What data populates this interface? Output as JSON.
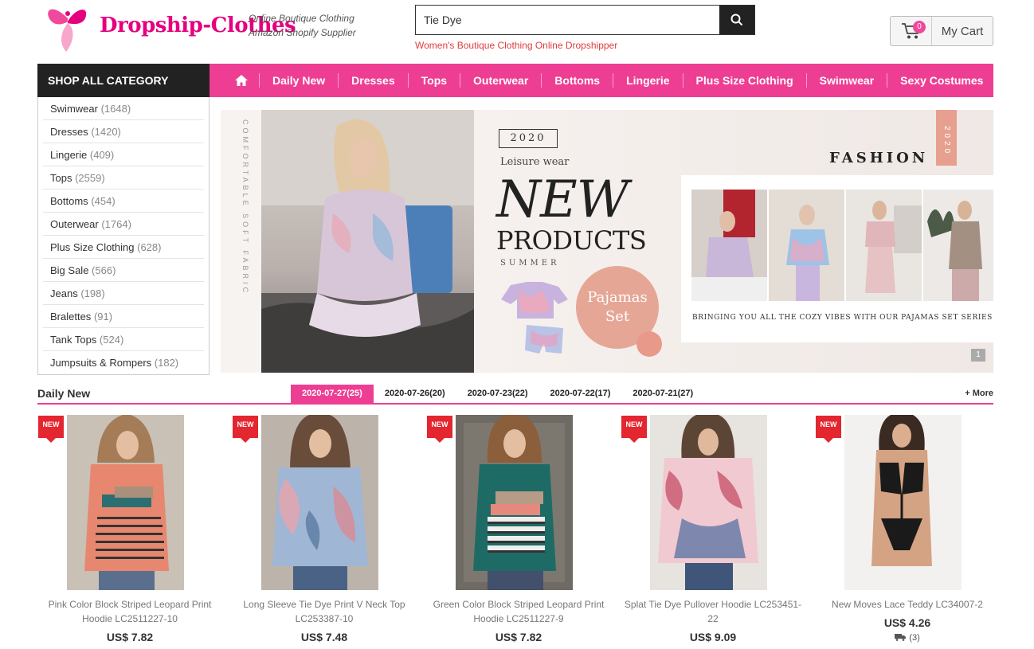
{
  "header": {
    "logo_text": "Dropship-Clothes",
    "tagline_1": "Online Boutique Clothing",
    "tagline_2": "Amazon Shopify Supplier",
    "search_value": "Tie Dye",
    "search_sub": "Women's Boutique Clothing Online Dropshipper",
    "cart_count": "0",
    "cart_label": "My Cart"
  },
  "nav": {
    "shop_all": "SHOP ALL CATEGORY",
    "home_icon": "home-icon",
    "items": [
      "Daily New",
      "Dresses",
      "Tops",
      "Outerwear",
      "Bottoms",
      "Lingerie",
      "Plus Size Clothing",
      "Swimwear",
      "Sexy Costumes"
    ]
  },
  "sidebar": {
    "categories": [
      {
        "name": "Swimwear",
        "count": "(1648)"
      },
      {
        "name": "Dresses",
        "count": "(1420)"
      },
      {
        "name": "Lingerie",
        "count": "(409)"
      },
      {
        "name": "Tops",
        "count": "(2559)"
      },
      {
        "name": "Bottoms",
        "count": "(454)"
      },
      {
        "name": "Outerwear",
        "count": "(1764)"
      },
      {
        "name": "Plus Size Clothing",
        "count": "(628)"
      },
      {
        "name": "Big Sale",
        "count": "(566)"
      },
      {
        "name": "Jeans",
        "count": "(198)"
      },
      {
        "name": "Bralettes",
        "count": "(91)"
      },
      {
        "name": "Tank Tops",
        "count": "(524)"
      },
      {
        "name": "Jumpsuits & Rompers",
        "count": "(182)"
      }
    ]
  },
  "banner": {
    "vertical_text": "COMFORTABLE SOFT FABRIC",
    "year": "2020",
    "leisure": "Leisure wear",
    "new": "NEW",
    "products": "PRODUCTS",
    "summer": "SUMMER",
    "pajamas_1": "Pajamas",
    "pajamas_2": "Set",
    "fashion": "FASHION",
    "tag": "2020",
    "caption": "BRINGING YOU ALL THE COZY VIBES WITH OUR PAJAMAS SET SERIES",
    "pager": "1"
  },
  "daily_new": {
    "title": "Daily New",
    "tabs": [
      "2020-07-27(25)",
      "2020-07-26(20)",
      "2020-07-23(22)",
      "2020-07-22(17)",
      "2020-07-21(27)"
    ],
    "active_tab": 0,
    "more": "+ More"
  },
  "products": [
    {
      "badge": "NEW",
      "name": "Pink Color Block Striped Leopard Print Hoodie  LC2511227-10",
      "price": "US$ 7.82"
    },
    {
      "badge": "NEW",
      "name": "Long Sleeve Tie Dye Print V Neck Top  LC253387-10",
      "price": "US$ 7.48"
    },
    {
      "badge": "NEW",
      "name": "Green Color Block Striped Leopard Print Hoodie  LC2511227-9",
      "price": "US$ 7.82"
    },
    {
      "badge": "NEW",
      "name": "Splat Tie Dye Pullover Hoodie  LC253451-22",
      "price": "US$ 9.09"
    },
    {
      "badge": "NEW",
      "name": "New Moves Lace Teddy  LC34007-2",
      "price": "US$ 4.26",
      "shipping": "(3)"
    }
  ],
  "colors": {
    "accent_pink": "#ee3e93",
    "dark": "#222222",
    "badge_red": "#e3262f",
    "brand_magenta": "#e4007f"
  }
}
